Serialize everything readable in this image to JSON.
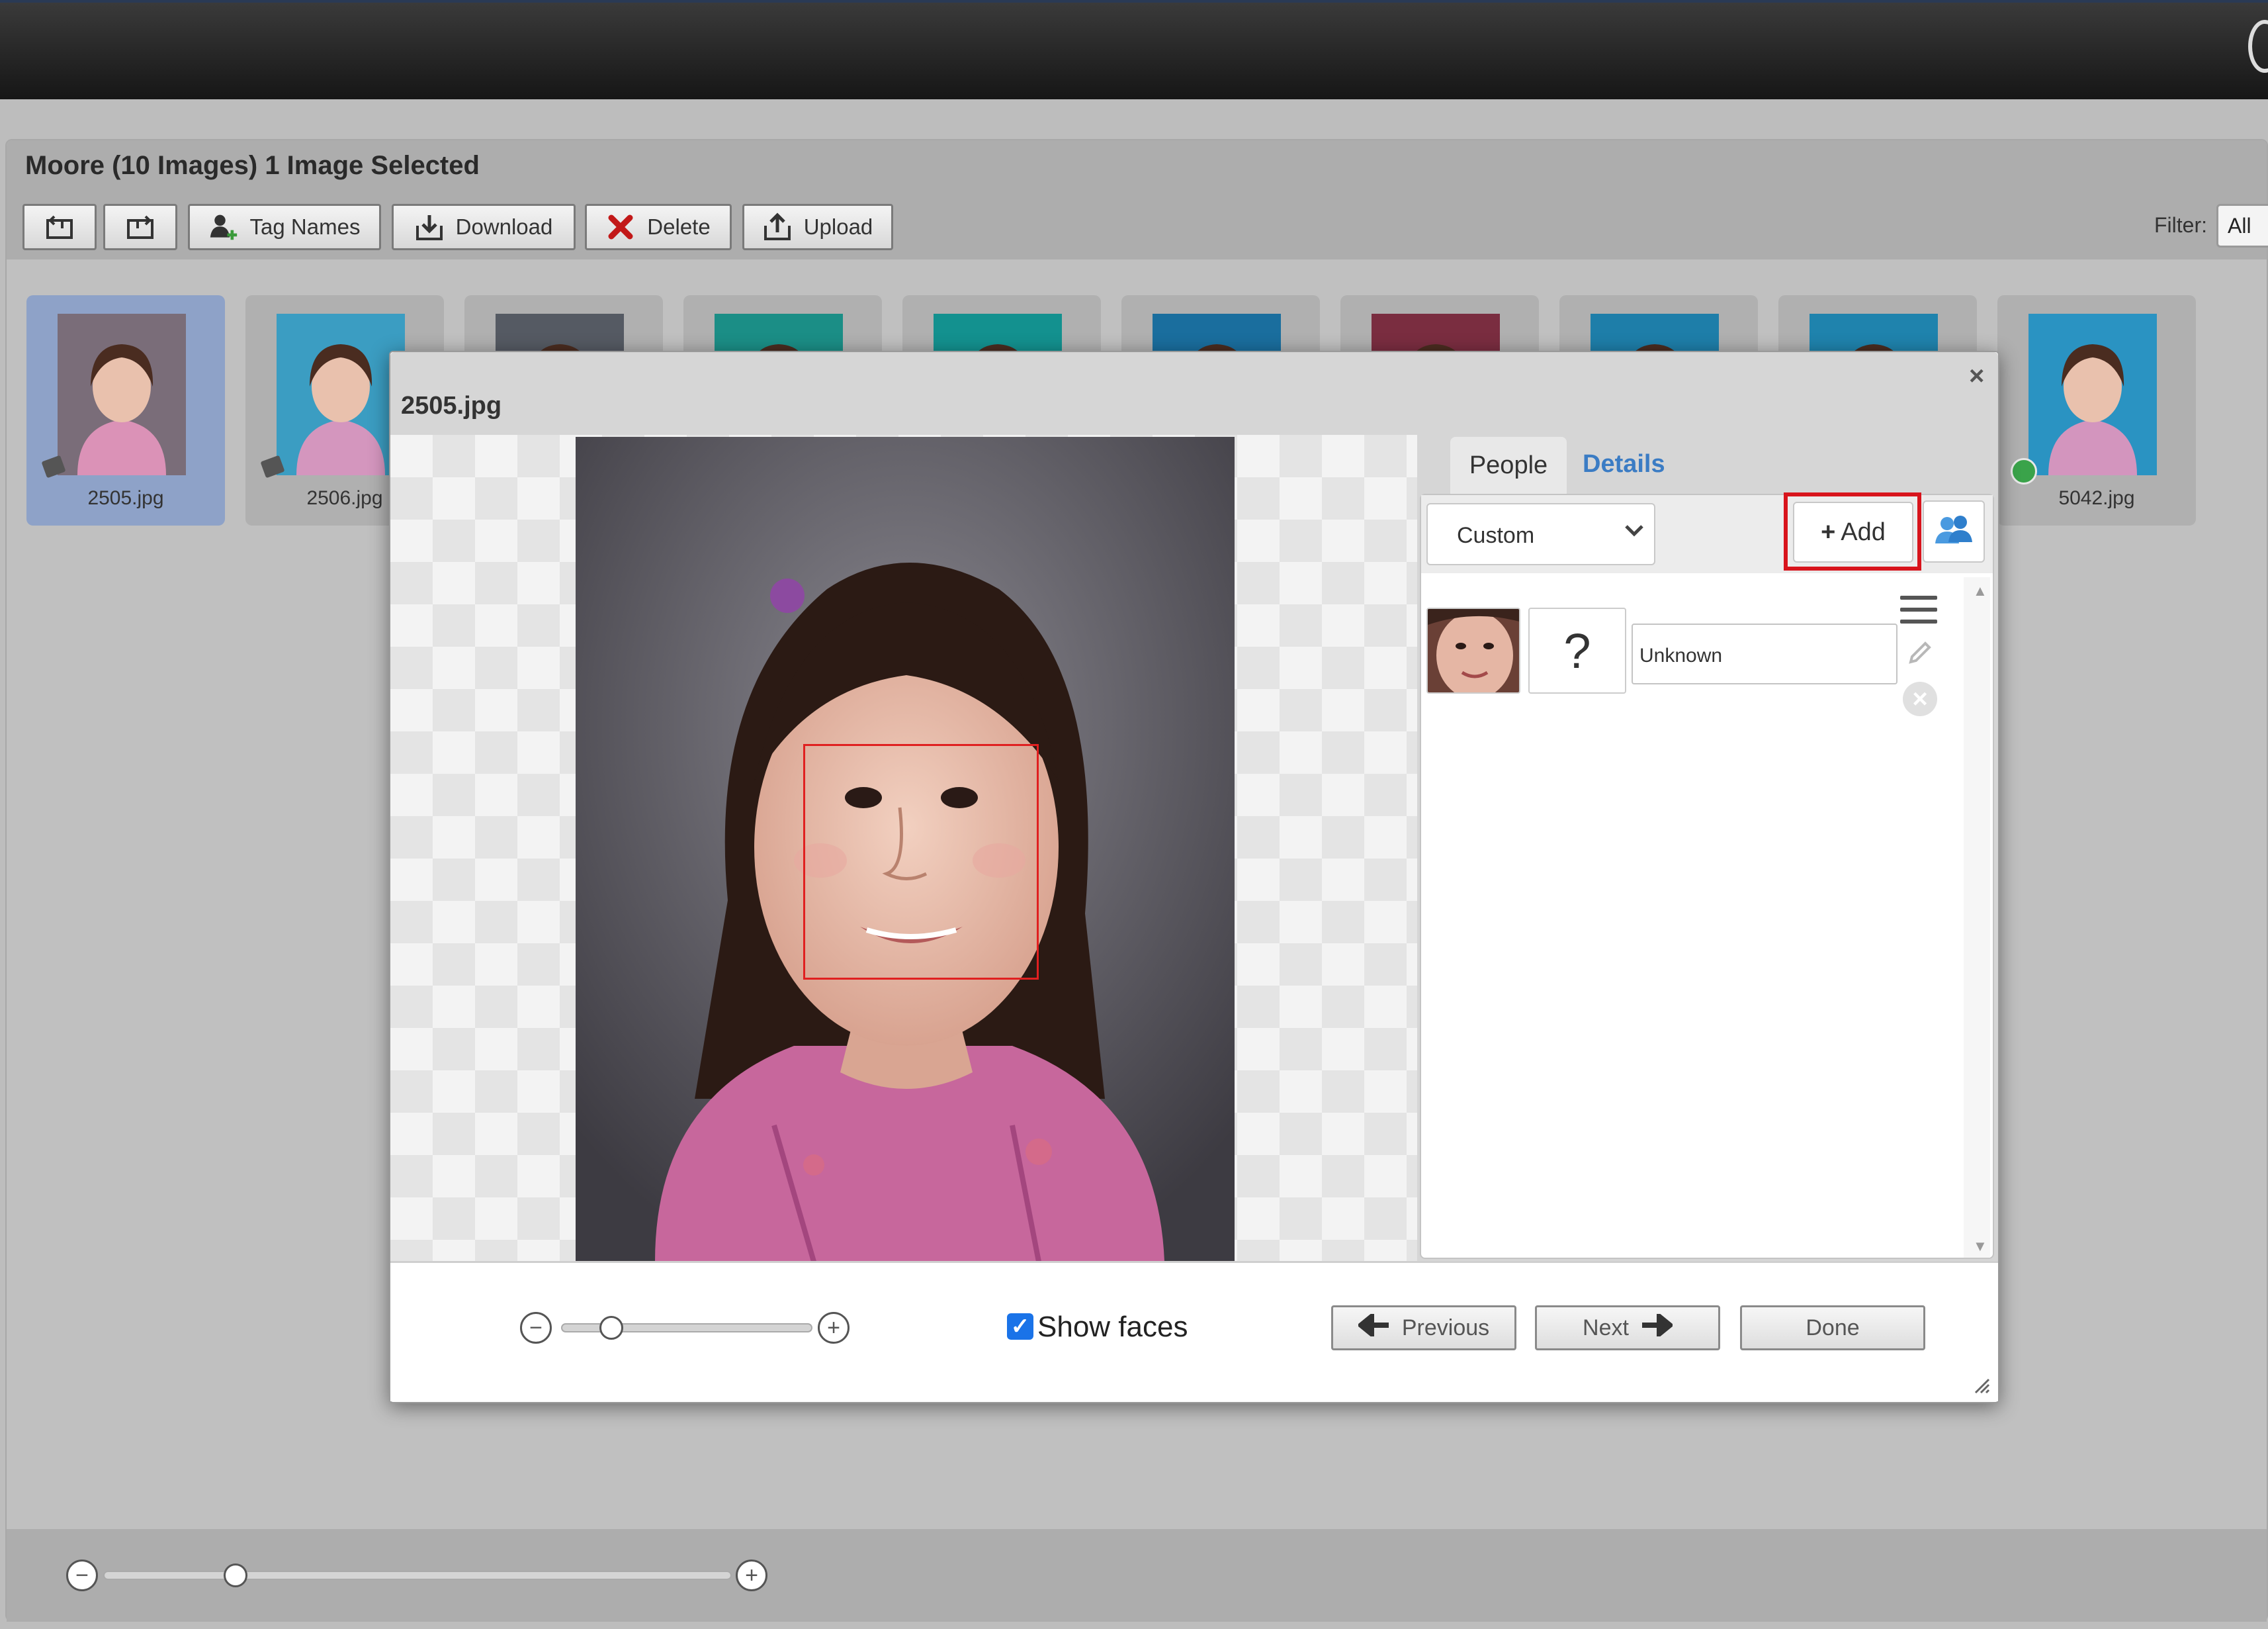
{
  "album": {
    "title": "Moore (10 Images) 1 Image Selected"
  },
  "toolbar": {
    "tag_names_label": "Tag Names",
    "download_label": "Download",
    "delete_label": "Delete",
    "upload_label": "Upload",
    "filter_label": "Filter:",
    "filter_value": "All"
  },
  "thumbnails": [
    {
      "name": "2505.jpg",
      "selected": true,
      "tagged": true,
      "bg": "#7a6d79"
    },
    {
      "name": "2506.jpg",
      "selected": false,
      "tagged": true,
      "bg": "#3b9dc2"
    },
    {
      "name": "",
      "selected": false,
      "bg": "#555a63"
    },
    {
      "name": "",
      "selected": false,
      "bg": "#1b8e86"
    },
    {
      "name": "",
      "selected": false,
      "bg": "#13918f"
    },
    {
      "name": "",
      "selected": false,
      "bg": "#1a6e9e"
    },
    {
      "name": "",
      "selected": false,
      "bg": "#7a2d40"
    },
    {
      "name": "",
      "selected": false,
      "bg": "#1e7ea9"
    },
    {
      "name": "",
      "selected": false,
      "bg": "#1f83ad"
    },
    {
      "name": "5042.jpg",
      "selected": false,
      "verified": true,
      "bg": "#2a93c2"
    }
  ],
  "modal": {
    "title": "2505.jpg",
    "close_glyph": "×",
    "tabs": {
      "people": "People",
      "details": "Details"
    },
    "group_select": "Custom",
    "add_label": "Add",
    "add_glyph": "+",
    "unknown_glyph": "?",
    "person_name": "Unknown",
    "show_faces_label": "Show faces",
    "show_faces_checked": true,
    "previous_label": "Previous",
    "next_label": "Next",
    "done_label": "Done",
    "zoom_level": 0.2
  },
  "bottom_zoom_level": 0.21,
  "colors": {
    "highlight": "#d8141c",
    "link": "#3b7cc4",
    "selected_thumb": "#8ea2c8",
    "face_box": "#e02020"
  }
}
